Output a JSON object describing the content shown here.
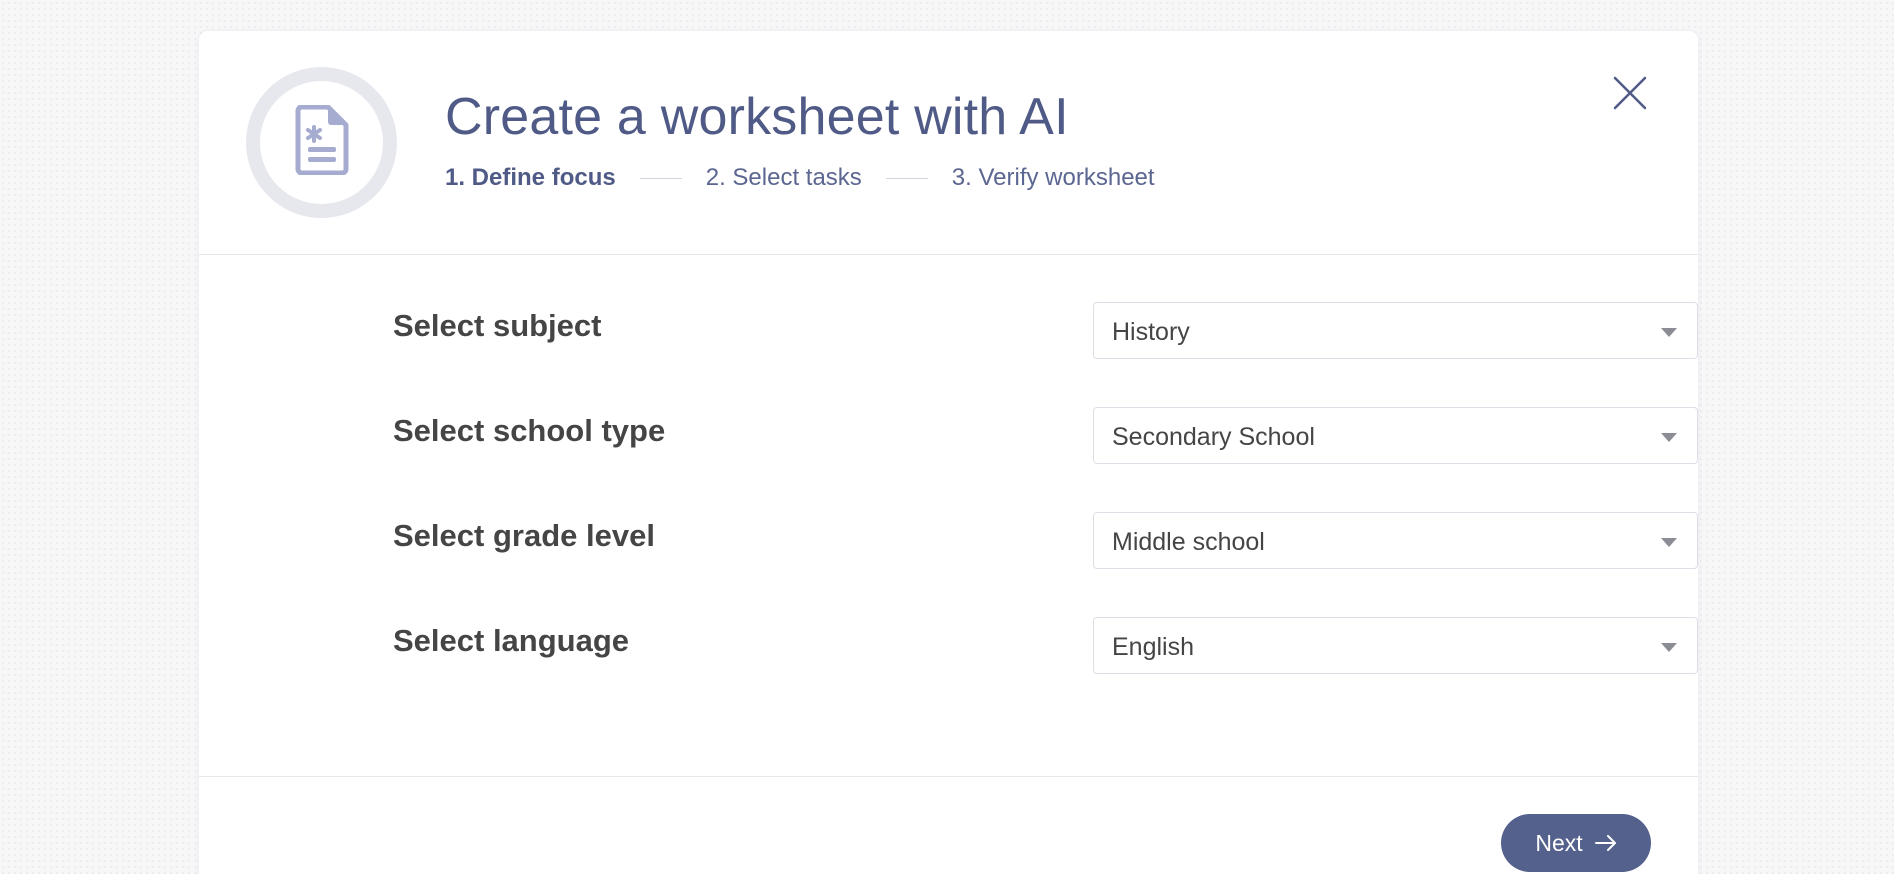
{
  "modal": {
    "title": "Create a worksheet with AI",
    "steps": [
      {
        "label": "1. Define focus",
        "active": true
      },
      {
        "label": "2. Select tasks",
        "active": false
      },
      {
        "label": "3. Verify worksheet",
        "active": false
      }
    ],
    "icons": {
      "badge": "document-asterisk-icon",
      "close": "close-icon",
      "next": "arrow-right-icon",
      "caret": "caret-down-icon"
    }
  },
  "form": {
    "subject": {
      "label": "Select subject",
      "value": "History"
    },
    "school_type": {
      "label": "Select school type",
      "value": "Secondary School"
    },
    "grade_level": {
      "label": "Select grade level",
      "value": "Middle school"
    },
    "language": {
      "label": "Select language",
      "value": "English"
    }
  },
  "footer": {
    "next_label": "Next"
  },
  "colors": {
    "accent": "#54618c",
    "title": "#4f5a86",
    "label": "#454545"
  }
}
